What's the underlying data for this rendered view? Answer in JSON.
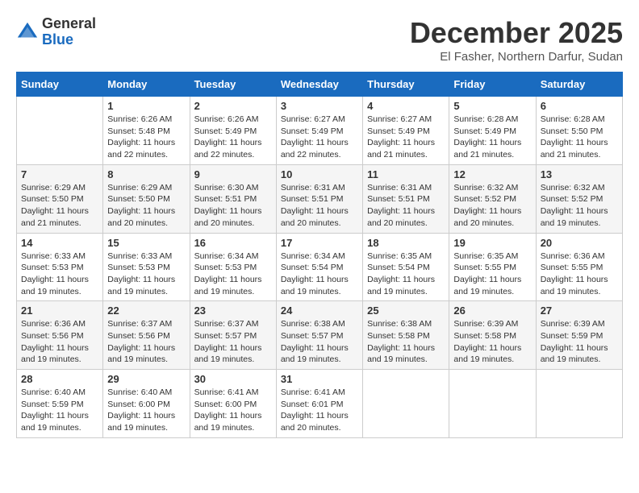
{
  "header": {
    "logo_line1": "General",
    "logo_line2": "Blue",
    "month": "December 2025",
    "location": "El Fasher, Northern Darfur, Sudan"
  },
  "days_of_week": [
    "Sunday",
    "Monday",
    "Tuesday",
    "Wednesday",
    "Thursday",
    "Friday",
    "Saturday"
  ],
  "weeks": [
    [
      {
        "day": "",
        "sunrise": "",
        "sunset": "",
        "daylight": ""
      },
      {
        "day": "1",
        "sunrise": "6:26 AM",
        "sunset": "5:48 PM",
        "daylight": "11 hours and 22 minutes."
      },
      {
        "day": "2",
        "sunrise": "6:26 AM",
        "sunset": "5:49 PM",
        "daylight": "11 hours and 22 minutes."
      },
      {
        "day": "3",
        "sunrise": "6:27 AM",
        "sunset": "5:49 PM",
        "daylight": "11 hours and 22 minutes."
      },
      {
        "day": "4",
        "sunrise": "6:27 AM",
        "sunset": "5:49 PM",
        "daylight": "11 hours and 21 minutes."
      },
      {
        "day": "5",
        "sunrise": "6:28 AM",
        "sunset": "5:49 PM",
        "daylight": "11 hours and 21 minutes."
      },
      {
        "day": "6",
        "sunrise": "6:28 AM",
        "sunset": "5:50 PM",
        "daylight": "11 hours and 21 minutes."
      }
    ],
    [
      {
        "day": "7",
        "sunrise": "6:29 AM",
        "sunset": "5:50 PM",
        "daylight": "11 hours and 21 minutes."
      },
      {
        "day": "8",
        "sunrise": "6:29 AM",
        "sunset": "5:50 PM",
        "daylight": "11 hours and 20 minutes."
      },
      {
        "day": "9",
        "sunrise": "6:30 AM",
        "sunset": "5:51 PM",
        "daylight": "11 hours and 20 minutes."
      },
      {
        "day": "10",
        "sunrise": "6:31 AM",
        "sunset": "5:51 PM",
        "daylight": "11 hours and 20 minutes."
      },
      {
        "day": "11",
        "sunrise": "6:31 AM",
        "sunset": "5:51 PM",
        "daylight": "11 hours and 20 minutes."
      },
      {
        "day": "12",
        "sunrise": "6:32 AM",
        "sunset": "5:52 PM",
        "daylight": "11 hours and 20 minutes."
      },
      {
        "day": "13",
        "sunrise": "6:32 AM",
        "sunset": "5:52 PM",
        "daylight": "11 hours and 19 minutes."
      }
    ],
    [
      {
        "day": "14",
        "sunrise": "6:33 AM",
        "sunset": "5:53 PM",
        "daylight": "11 hours and 19 minutes."
      },
      {
        "day": "15",
        "sunrise": "6:33 AM",
        "sunset": "5:53 PM",
        "daylight": "11 hours and 19 minutes."
      },
      {
        "day": "16",
        "sunrise": "6:34 AM",
        "sunset": "5:53 PM",
        "daylight": "11 hours and 19 minutes."
      },
      {
        "day": "17",
        "sunrise": "6:34 AM",
        "sunset": "5:54 PM",
        "daylight": "11 hours and 19 minutes."
      },
      {
        "day": "18",
        "sunrise": "6:35 AM",
        "sunset": "5:54 PM",
        "daylight": "11 hours and 19 minutes."
      },
      {
        "day": "19",
        "sunrise": "6:35 AM",
        "sunset": "5:55 PM",
        "daylight": "11 hours and 19 minutes."
      },
      {
        "day": "20",
        "sunrise": "6:36 AM",
        "sunset": "5:55 PM",
        "daylight": "11 hours and 19 minutes."
      }
    ],
    [
      {
        "day": "21",
        "sunrise": "6:36 AM",
        "sunset": "5:56 PM",
        "daylight": "11 hours and 19 minutes."
      },
      {
        "day": "22",
        "sunrise": "6:37 AM",
        "sunset": "5:56 PM",
        "daylight": "11 hours and 19 minutes."
      },
      {
        "day": "23",
        "sunrise": "6:37 AM",
        "sunset": "5:57 PM",
        "daylight": "11 hours and 19 minutes."
      },
      {
        "day": "24",
        "sunrise": "6:38 AM",
        "sunset": "5:57 PM",
        "daylight": "11 hours and 19 minutes."
      },
      {
        "day": "25",
        "sunrise": "6:38 AM",
        "sunset": "5:58 PM",
        "daylight": "11 hours and 19 minutes."
      },
      {
        "day": "26",
        "sunrise": "6:39 AM",
        "sunset": "5:58 PM",
        "daylight": "11 hours and 19 minutes."
      },
      {
        "day": "27",
        "sunrise": "6:39 AM",
        "sunset": "5:59 PM",
        "daylight": "11 hours and 19 minutes."
      }
    ],
    [
      {
        "day": "28",
        "sunrise": "6:40 AM",
        "sunset": "5:59 PM",
        "daylight": "11 hours and 19 minutes."
      },
      {
        "day": "29",
        "sunrise": "6:40 AM",
        "sunset": "6:00 PM",
        "daylight": "11 hours and 19 minutes."
      },
      {
        "day": "30",
        "sunrise": "6:41 AM",
        "sunset": "6:00 PM",
        "daylight": "11 hours and 19 minutes."
      },
      {
        "day": "31",
        "sunrise": "6:41 AM",
        "sunset": "6:01 PM",
        "daylight": "11 hours and 20 minutes."
      },
      {
        "day": "",
        "sunrise": "",
        "sunset": "",
        "daylight": ""
      },
      {
        "day": "",
        "sunrise": "",
        "sunset": "",
        "daylight": ""
      },
      {
        "day": "",
        "sunrise": "",
        "sunset": "",
        "daylight": ""
      }
    ]
  ]
}
